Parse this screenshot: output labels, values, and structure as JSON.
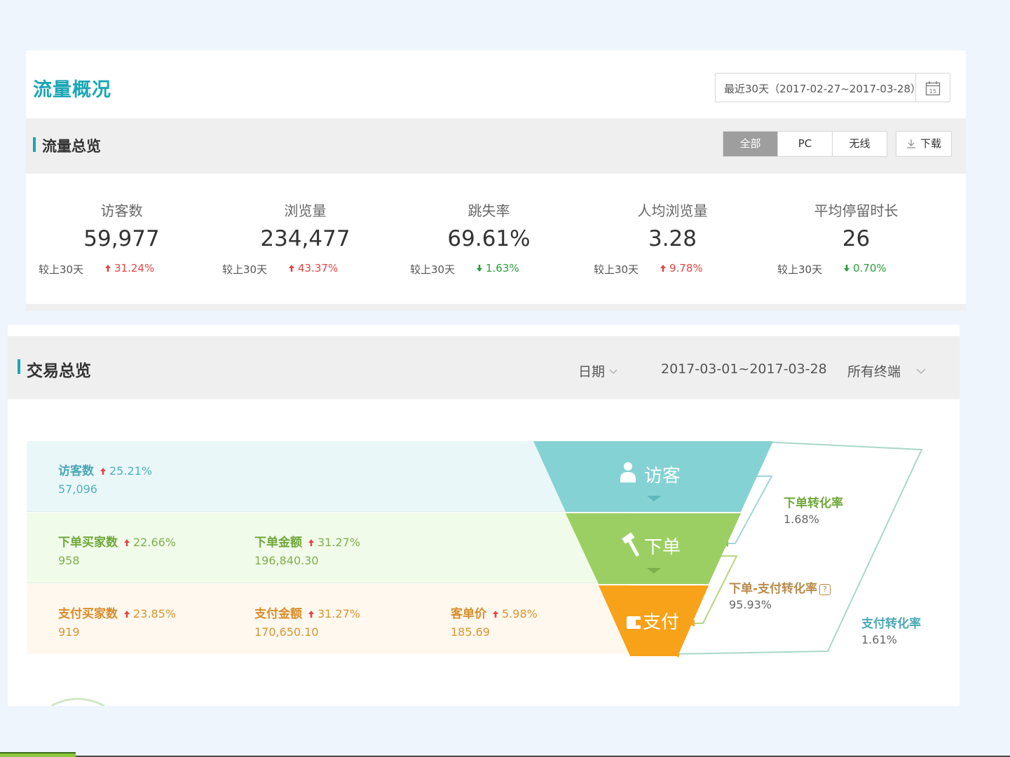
{
  "header": {
    "title": "流量概况",
    "date_range": "最近30天（2017-02-27~2017-03-28）",
    "calendar_day": "15"
  },
  "traffic": {
    "title": "流量总览",
    "filters": [
      "全部",
      "PC",
      "无线"
    ],
    "active_filter": "全部",
    "download_label": "下载",
    "metrics": [
      {
        "label": "访客数",
        "value": "59,977",
        "compare": "较上30天",
        "change": "31.24%",
        "trend": "up"
      },
      {
        "label": "浏览量",
        "value": "234,477",
        "compare": "较上30天",
        "change": "43.37%",
        "trend": "up"
      },
      {
        "label": "跳失率",
        "value": "69.61%",
        "compare": "较上30天",
        "change": "1.63%",
        "trend": "down"
      },
      {
        "label": "人均浏览量",
        "value": "3.28",
        "compare": "较上30天",
        "change": "9.78%",
        "trend": "up"
      },
      {
        "label": "平均停留时长",
        "value": "26",
        "compare": "较上30天",
        "change": "0.70%",
        "trend": "down"
      }
    ]
  },
  "trade": {
    "title": "交易总览",
    "date_filter": "日期",
    "date_range": "2017-03-01~2017-03-28",
    "terminal_filter": "所有终端",
    "visit": {
      "stats": [
        {
          "label": "访客数",
          "change": "25.21%",
          "value": "57,096"
        }
      ]
    },
    "order": {
      "stats": [
        {
          "label": "下单买家数",
          "change": "22.66%",
          "value": "958"
        },
        {
          "label": "下单金额",
          "change": "31.27%",
          "value": "196,840.30"
        }
      ]
    },
    "pay": {
      "stats": [
        {
          "label": "支付买家数",
          "change": "23.85%",
          "value": "919"
        },
        {
          "label": "支付金额",
          "change": "31.27%",
          "value": "170,650.10"
        },
        {
          "label": "客单价",
          "change": "5.98%",
          "value": "185.69"
        }
      ]
    },
    "funnel": {
      "visit_label": "访客",
      "order_label": "下单",
      "pay_label": "支付",
      "order_rate_label": "下单转化率",
      "order_rate": "1.68%",
      "order_pay_rate_label": "下单-支付转化率",
      "order_pay_rate": "95.93%",
      "help_glyph": "?",
      "pay_rate_label": "支付转化率",
      "pay_rate": "1.61%"
    },
    "colors": {
      "visit": "#85d2d4",
      "order": "#9ccf63",
      "pay": "#f8a21a",
      "up": "#e64545",
      "down": "#2a9d3a"
    }
  }
}
